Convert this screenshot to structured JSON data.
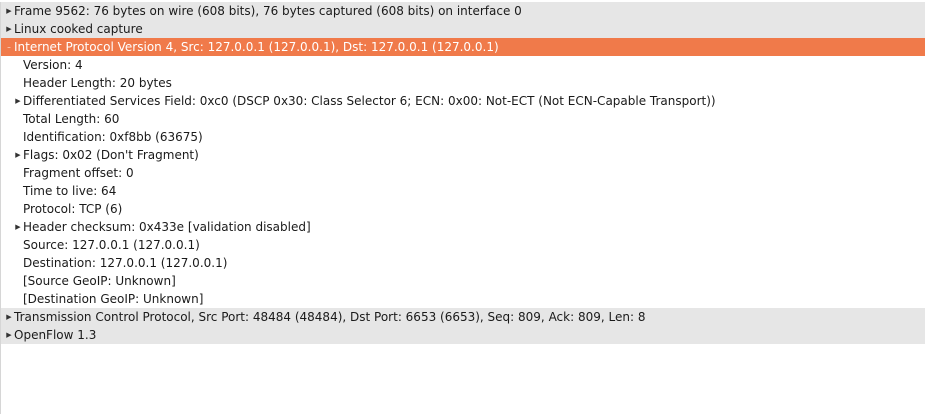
{
  "tree": [
    {
      "label": "Frame 9562: 76 bytes on wire (608 bits), 76 bytes captured (608 bits) on interface 0",
      "level": 0,
      "expander": "collapsed",
      "style": "top",
      "name": "tree-item-frame"
    },
    {
      "label": "Linux cooked capture",
      "level": 0,
      "expander": "collapsed",
      "style": "top",
      "name": "tree-item-linux-cooked-capture"
    },
    {
      "label": "Internet Protocol Version 4, Src: 127.0.0.1 (127.0.0.1), Dst: 127.0.0.1 (127.0.0.1)",
      "level": 0,
      "expander": "expanded",
      "style": "selected",
      "name": "tree-item-ipv4"
    },
    {
      "label": "Version: 4",
      "level": 1,
      "expander": "none",
      "style": "",
      "name": "tree-item-version"
    },
    {
      "label": "Header Length: 20 bytes",
      "level": 1,
      "expander": "none",
      "style": "",
      "name": "tree-item-header-length"
    },
    {
      "label": "Differentiated Services Field: 0xc0 (DSCP 0x30: Class Selector 6; ECN: 0x00: Not-ECT (Not ECN-Capable Transport))",
      "level": 1,
      "expander": "collapsed",
      "style": "",
      "name": "tree-item-dsfield"
    },
    {
      "label": "Total Length: 60",
      "level": 1,
      "expander": "none",
      "style": "",
      "name": "tree-item-total-length"
    },
    {
      "label": "Identification: 0xf8bb (63675)",
      "level": 1,
      "expander": "none",
      "style": "",
      "name": "tree-item-identification"
    },
    {
      "label": "Flags: 0x02 (Don't Fragment)",
      "level": 1,
      "expander": "collapsed",
      "style": "",
      "name": "tree-item-flags"
    },
    {
      "label": "Fragment offset: 0",
      "level": 1,
      "expander": "none",
      "style": "",
      "name": "tree-item-fragment-offset"
    },
    {
      "label": "Time to live: 64",
      "level": 1,
      "expander": "none",
      "style": "",
      "name": "tree-item-ttl"
    },
    {
      "label": "Protocol: TCP (6)",
      "level": 1,
      "expander": "none",
      "style": "",
      "name": "tree-item-protocol"
    },
    {
      "label": "Header checksum: 0x433e [validation disabled]",
      "level": 1,
      "expander": "collapsed",
      "style": "",
      "name": "tree-item-header-checksum"
    },
    {
      "label": "Source: 127.0.0.1 (127.0.0.1)",
      "level": 1,
      "expander": "none",
      "style": "",
      "name": "tree-item-source"
    },
    {
      "label": "Destination: 127.0.0.1 (127.0.0.1)",
      "level": 1,
      "expander": "none",
      "style": "",
      "name": "tree-item-destination"
    },
    {
      "label": "[Source GeoIP: Unknown]",
      "level": 1,
      "expander": "none",
      "style": "",
      "name": "tree-item-source-geoip"
    },
    {
      "label": "[Destination GeoIP: Unknown]",
      "level": 1,
      "expander": "none",
      "style": "",
      "name": "tree-item-destination-geoip"
    },
    {
      "label": "Transmission Control Protocol, Src Port: 48484 (48484), Dst Port: 6653 (6653), Seq: 809, Ack: 809, Len: 8",
      "level": 0,
      "expander": "collapsed",
      "style": "top",
      "name": "tree-item-tcp"
    },
    {
      "label": "OpenFlow 1.3",
      "level": 0,
      "expander": "collapsed",
      "style": "top",
      "name": "tree-item-openflow"
    }
  ],
  "icons": {
    "collapsed": "expand-arrow-icon",
    "expanded": "collapse-arrow-icon"
  },
  "colors": {
    "selected_background": "#f07a4a",
    "top_level_background": "#e6e6e6"
  }
}
